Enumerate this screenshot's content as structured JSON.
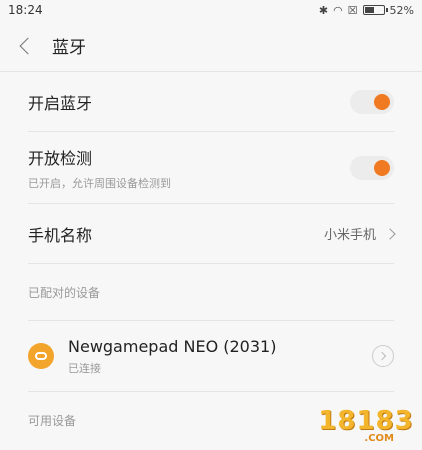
{
  "status": {
    "time": "18:24",
    "battery_text": "52%",
    "battery_level": 0.52
  },
  "header": {
    "title": "蓝牙"
  },
  "settings": {
    "bluetooth_on_label": "开启蓝牙",
    "bluetooth_on": true,
    "visibility_label": "开放检测",
    "visibility_sub": "已开启，允许周围设备检测到",
    "visibility_on": true,
    "device_name_label": "手机名称",
    "device_name_value": "小米手机"
  },
  "paired": {
    "header": "已配对的设备",
    "devices": [
      {
        "name": "Newgamepad NEO (2031)",
        "status": "已连接"
      }
    ]
  },
  "available": {
    "header": "可用设备"
  },
  "watermark": {
    "text": "18183",
    "sub": ".COM"
  },
  "colors": {
    "accent": "#f07a22",
    "device_icon": "#f3a42b"
  }
}
